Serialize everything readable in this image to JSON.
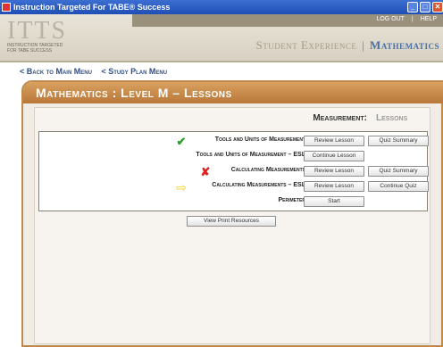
{
  "window": {
    "title": "Instruction Targeted For TABE® Success"
  },
  "banner": {
    "logo": "ITTS",
    "logo_tagline": "INSTRUCTION TARGETED FOR TABE SUCCESS",
    "links": [
      "LOG OUT",
      "|",
      "HELP"
    ],
    "section": "Student Experience",
    "separator": "|",
    "subject": "Mathematics"
  },
  "nav": {
    "back_main": "< Back to Main Menu",
    "study_plan": "< Study Plan Menu"
  },
  "panel": {
    "title": "Mathematics : Level M – Lessons",
    "subheading_label": "Measurement:",
    "subheading_value": "Lessons"
  },
  "lessons": [
    {
      "status_icon": "check-icon",
      "name": "Tools and Units of Measurement",
      "btn1": "Review Lesson",
      "btn2": "Quiz Summary"
    },
    {
      "status_icon": "",
      "name": "Tools and Units of Measurement – ESL",
      "btn1": "Continue Lesson",
      "btn2": ""
    },
    {
      "status_icon": "cross-icon",
      "name": "Calculating Measurements",
      "btn1": "Review Lesson",
      "btn2": "Quiz Summary"
    },
    {
      "status_icon": "arrow-icon",
      "name": "Calculating Measurements – ESL",
      "btn1": "Review Lesson",
      "btn2": "Continue Quiz"
    },
    {
      "status_icon": "",
      "name": "Perimeter",
      "btn1": "Start",
      "btn2": ""
    }
  ],
  "print_button": "View Print Resources",
  "colors": {
    "accent": "#bf8a4c",
    "link": "#2d4f86",
    "check": "#2aa02a",
    "cross": "#e02020",
    "arrow": "#f2d21c"
  }
}
